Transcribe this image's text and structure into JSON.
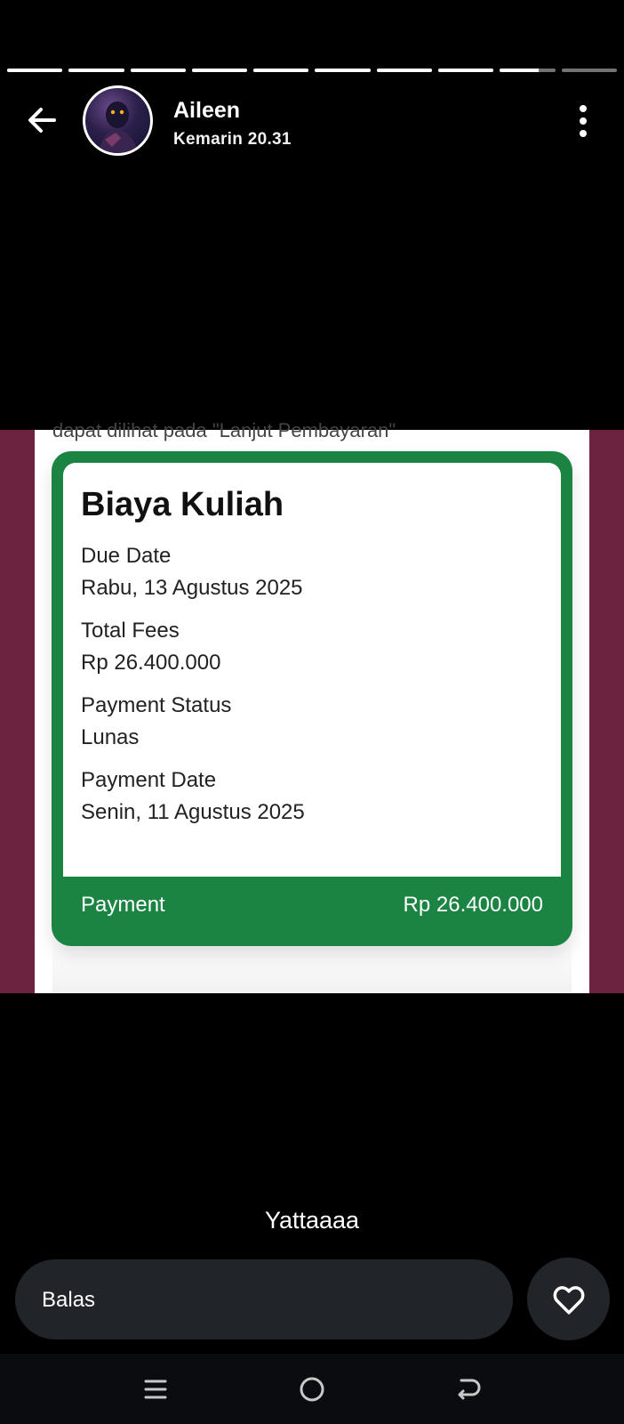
{
  "story": {
    "progress_segments": [
      1,
      1,
      1,
      1,
      1,
      1,
      1,
      1,
      0.7,
      0
    ],
    "user_name": "Aileen",
    "timestamp": "Kemarin 20.31",
    "caption": "Yattaaaa"
  },
  "image": {
    "cut_off_text": "dapat dilihat pada \"Lanjut Pembayaran\"",
    "card": {
      "title": "Biaya Kuliah",
      "fields": [
        {
          "label": "Due Date",
          "value": "Rabu, 13 Agustus 2025"
        },
        {
          "label": "Total Fees",
          "value": "Rp 26.400.000"
        },
        {
          "label": "Payment Status",
          "value": "Lunas"
        },
        {
          "label": "Payment Date",
          "value": "Senin, 11 Agustus 2025"
        }
      ],
      "footer_label": "Payment",
      "footer_amount": "Rp 26.400.000"
    }
  },
  "reply": {
    "placeholder": "Balas"
  },
  "icons": {
    "back": "arrow-left-icon",
    "more": "more-vertical-icon",
    "like": "heart-icon",
    "nav_recents": "recents-icon",
    "nav_home": "home-icon",
    "nav_back": "back-icon"
  },
  "colors": {
    "card_green": "#1b8443",
    "story_background": "#6b2340",
    "reply_background": "#212529"
  }
}
